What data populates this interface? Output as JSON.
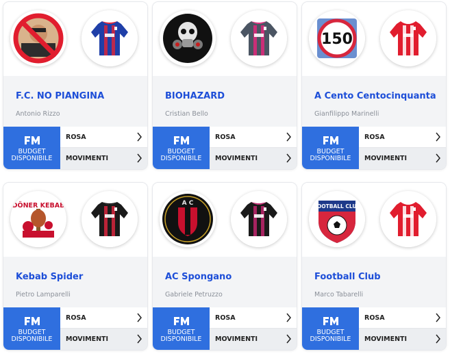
{
  "teams": [
    {
      "name": "F.C. NO PIANGINA",
      "manager": "Antonio Rizzo",
      "logo_icon": "crying-man-no-sign-logo-icon",
      "kit_icon": "blue-red-striped-jersey-icon",
      "kit": {
        "main": "#1f3fa8",
        "stripe": "#d7263d",
        "collar": "#e11d2e"
      }
    },
    {
      "name": "BIOHAZARD",
      "manager": "Cristian Bello",
      "logo_icon": "gas-mask-skull-logo-icon",
      "kit_icon": "grey-pink-jersey-icon",
      "kit": {
        "main": "#4b5563",
        "stripe": "#e0287a",
        "collar": "#e0287a"
      }
    },
    {
      "name": "A Cento Centocinquanta",
      "manager": "Gianfilippo Marinelli",
      "logo_icon": "speed-limit-150-sign-logo-icon",
      "logo_text": "150",
      "kit_icon": "red-white-spider-jersey-icon",
      "kit": {
        "main": "#e11d2e",
        "stripe": "#ffffff",
        "collar": "#ffffff"
      }
    },
    {
      "name": "Kebab Spider",
      "manager": "Pietro Lamparelli",
      "logo_icon": "doner-kebab-chef-logo-icon",
      "logo_text": "DÖNER KEBAB",
      "kit_icon": "red-black-striped-jersey-icon",
      "kit": {
        "main": "#1a1a1a",
        "stripe": "#d7263d",
        "collar": "#1a1a1a"
      }
    },
    {
      "name": "AC Spongano",
      "manager": "Gabriele Petruzzo",
      "logo_icon": "ac-spongano-crest-logo-icon",
      "kit_icon": "black-magenta-striped-jersey-icon",
      "kit": {
        "main": "#1a1a1a",
        "stripe": "#c0266d",
        "collar": "#c0266d"
      }
    },
    {
      "name": "Football Club",
      "manager": "Marco Tabarelli",
      "logo_icon": "football-club-shield-logo-icon",
      "logo_text": "FOOTBALL CLUB",
      "kit_icon": "red-white-jersey-icon",
      "kit": {
        "main": "#e11d2e",
        "stripe": "#ffffff",
        "collar": "#ffffff"
      }
    }
  ],
  "labels": {
    "budget_line1": "BUDGET",
    "budget_line2": "DISPONIBILE",
    "rosa": "ROSA",
    "movimenti": "MOVIMENTI"
  },
  "colors": {
    "accent": "#2f6fdf",
    "team_name": "#1d4ed8",
    "card_mid": "#f3f4f6"
  }
}
